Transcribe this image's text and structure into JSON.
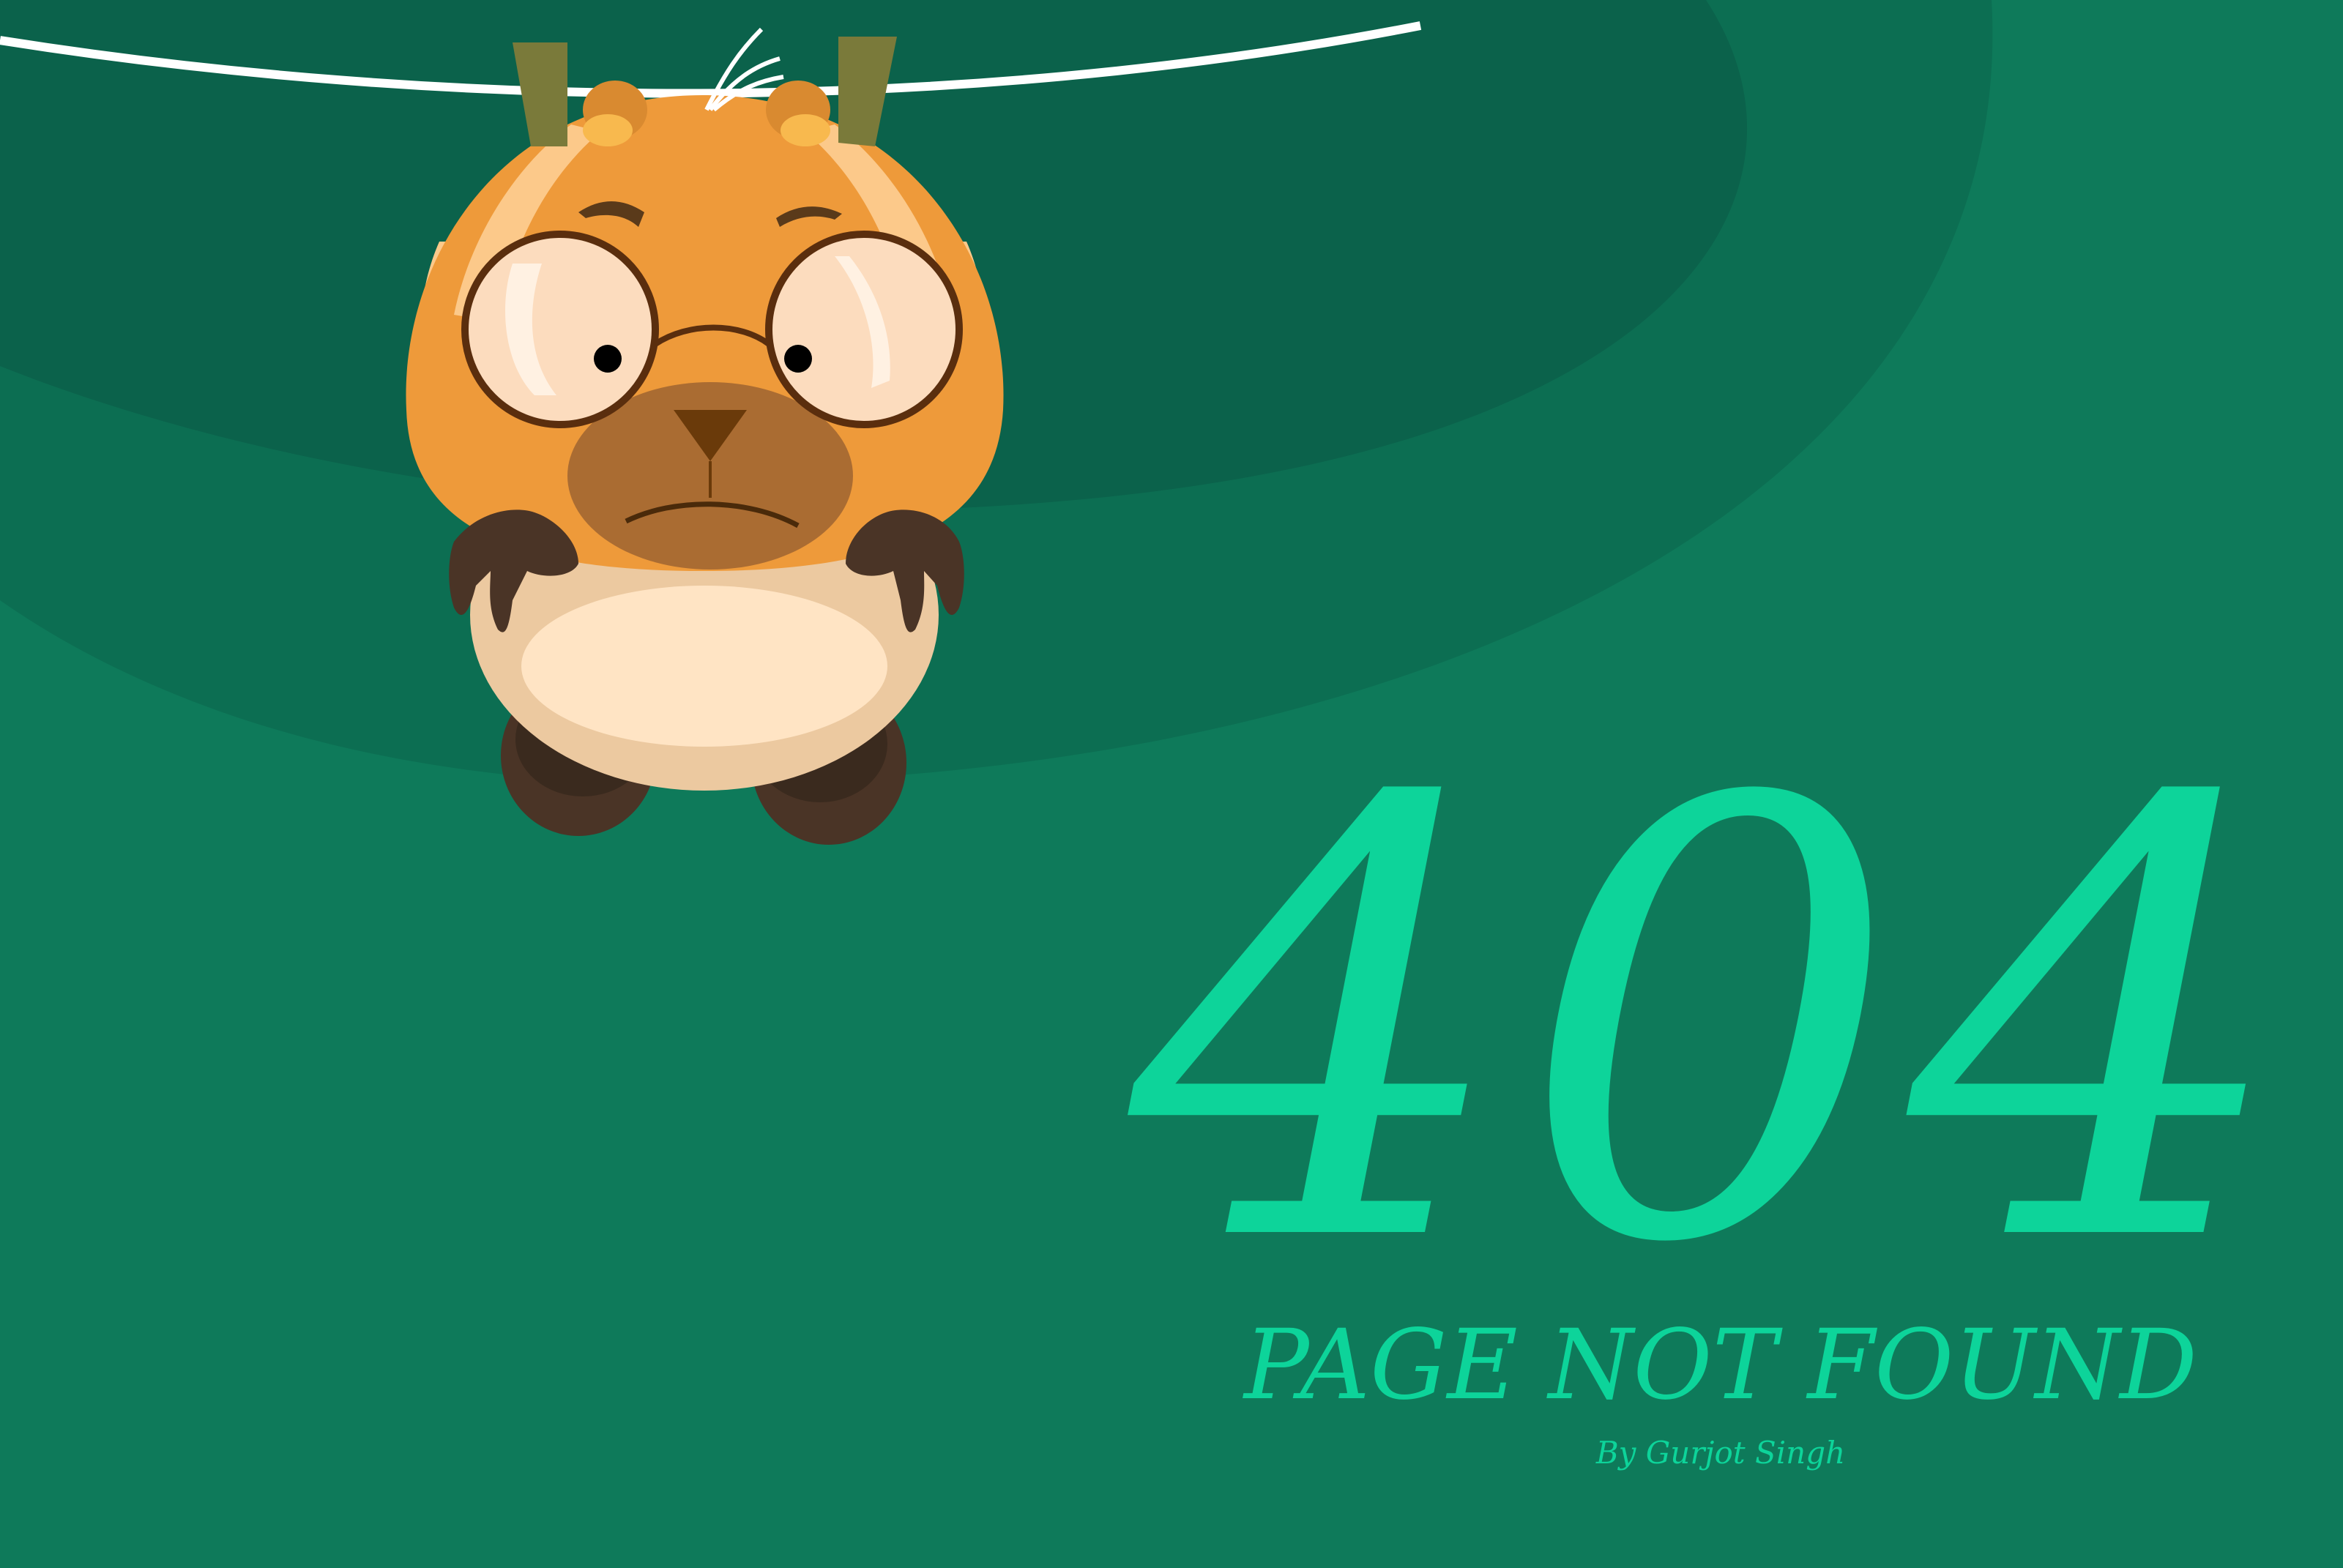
{
  "page": {
    "error_code": "404",
    "error_message": "PAGE NOT FOUND",
    "credit": "By Gurjot Singh"
  },
  "illustration": {
    "subject": "hamster-hanging-on-clothesline",
    "icons": [
      "clothesline-icon",
      "clothespin-icon",
      "hamster-icon",
      "glasses-icon"
    ]
  },
  "colors": {
    "background": "#0e7a5a",
    "background_dark_band": "#0c6e52",
    "background_darkest_band": "#0b624b",
    "accent_text": "#0dd49a",
    "hamster_fur": "#ee9a3a",
    "hamster_belly": "#ffe4c4",
    "hamster_paws": "#4a3426",
    "clothesline": "#ffffff",
    "clothespin": "#7a7a3a"
  }
}
